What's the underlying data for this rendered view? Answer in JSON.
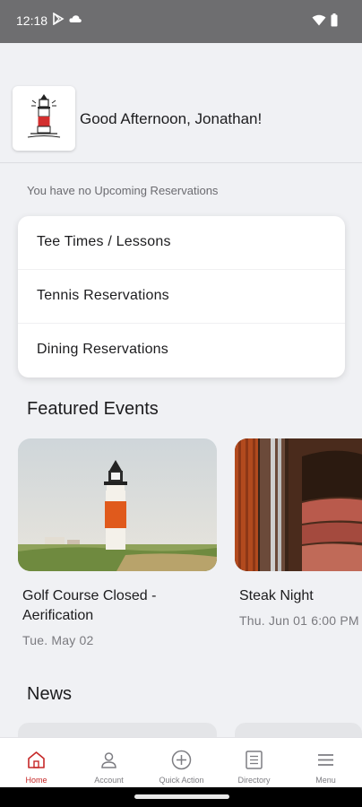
{
  "status_bar": {
    "time": "12:18"
  },
  "greeting": {
    "text": "Good Afternoon, Jonathan!"
  },
  "reservations": {
    "empty_message": "You have no Upcoming Reservations",
    "items": [
      {
        "label": "Tee Times / Lessons"
      },
      {
        "label": "Tennis Reservations"
      },
      {
        "label": "Dining Reservations"
      }
    ]
  },
  "featured_events": {
    "title": "Featured Events",
    "events": [
      {
        "title": "Golf Course Closed - Aerification",
        "date": "Tue. May 02"
      },
      {
        "title": "Steak Night",
        "date": "Thu. Jun 01 6:00 PM"
      }
    ]
  },
  "news": {
    "title": "News"
  },
  "bottom_nav": {
    "items": [
      {
        "label": "Home",
        "icon": "home-icon",
        "active": true
      },
      {
        "label": "Account",
        "icon": "person-icon",
        "active": false
      },
      {
        "label": "Quick Action",
        "icon": "plus-circle-icon",
        "active": false
      },
      {
        "label": "Directory",
        "icon": "list-icon",
        "active": false
      },
      {
        "label": "Menu",
        "icon": "hamburger-menu-icon",
        "active": false
      }
    ]
  },
  "colors": {
    "accent": "#c62828",
    "background": "#f0f1f4",
    "status_bar": "#6e6e70"
  }
}
